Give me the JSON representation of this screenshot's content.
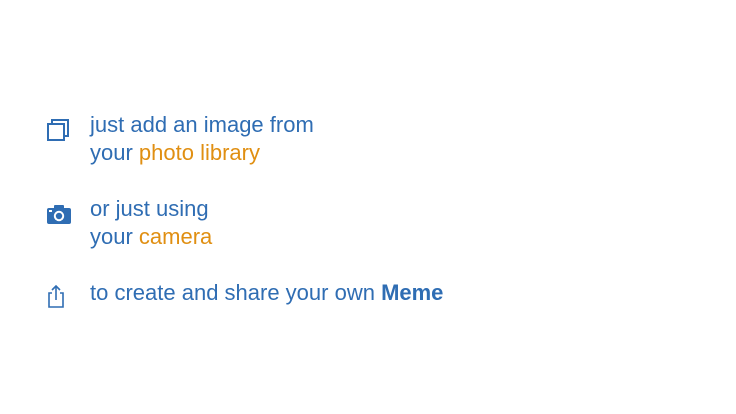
{
  "colors": {
    "text_blue": "#2f6db3",
    "accent_orange": "#e08f12",
    "background": "#ffffff"
  },
  "rows": [
    {
      "icon": "photo-library-icon",
      "line1": "just add an image from",
      "line2_prefix": "your ",
      "line2_highlight": "photo library"
    },
    {
      "icon": "camera-icon",
      "line1": "or just using",
      "line2_prefix": "your ",
      "line2_highlight": "camera"
    },
    {
      "icon": "share-icon",
      "line1_prefix": "to create and share your own ",
      "line1_bold": "Meme"
    }
  ]
}
